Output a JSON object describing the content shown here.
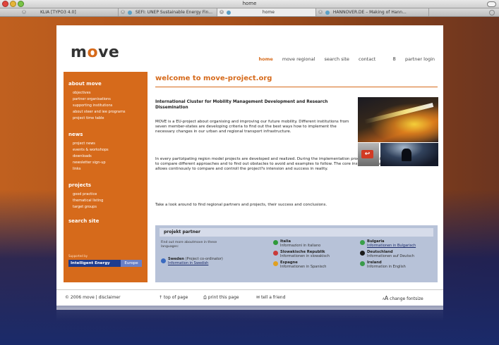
{
  "window": {
    "title": "home",
    "tabs": [
      {
        "label": "KLIA [TYPO3 4.0]"
      },
      {
        "label": "SEFI: UNEP Sustainable Energy Fin..."
      },
      {
        "label": "home"
      },
      {
        "label": "HANNOVER.DE – Making of Hann..."
      }
    ]
  },
  "site": {
    "logo": {
      "m": "m",
      "o": "o",
      "ve": "ve"
    },
    "topnav": [
      "home",
      "move regional",
      "search site",
      "contact"
    ],
    "login": {
      "key": "8",
      "label": "partner login"
    }
  },
  "sidebar": {
    "sections": [
      {
        "title": "about move",
        "items": [
          "objectives",
          "partner organisations",
          "supporting institutions",
          "about steer and iee programs",
          "project time table"
        ]
      },
      {
        "title": "news",
        "items": [
          "project news",
          "events & workshops",
          "downloads",
          "newsletter sign-up",
          "links"
        ]
      },
      {
        "title": "projects",
        "items": [
          "good practice",
          "thematical listing",
          "target groups"
        ]
      },
      {
        "title": "search site",
        "items": []
      }
    ],
    "supported_by": "Supported by",
    "badge_left": "Intelligent Energy",
    "badge_right": "Europe"
  },
  "content": {
    "heading": "welcome to move-project.org",
    "intro_title": "International Cluster for Mobility Management Development and Research Dissemination",
    "paragraph1": "MOVE is a EU-project about organising and improving our future mobility. Different institutions from seven member-states are developing criteria to find out the best ways how to implement the necessary changes in our urban and regional transport infrastructure.",
    "paragraph2": "In every partizipating region model projects are developed and realized. During the implementation process a detailed evaluation will take place to compare different approaches and to find out obstacles to avoid and examples to follow. The core instrument is a fixed table of criteria, which allows continously to compare and controll the project?s intension and success in reality.",
    "paragraph3": "Take a look around to find regional partners and projects, their success and conclusions.",
    "photo_arrow": "↩"
  },
  "partner": {
    "heading": "projekt partner",
    "lead": "Find out more aboutmove in these languages:",
    "sweden": {
      "name": "Sweden",
      "note": "(Project co-ordinator)",
      "link": "Information in Swedish"
    },
    "countries": [
      {
        "name": "Italia",
        "text": "Informazioni in italiano",
        "color": "#2e9a3a"
      },
      {
        "name": "Slowakische Republik",
        "text": "Informationen in slowakisch",
        "color": "#c93a3a"
      },
      {
        "name": "Espagne",
        "text": "Informationen in Spanisch",
        "color": "#e0a020"
      },
      {
        "name": "Bulgaria",
        "text": "Informationen in Bulgarisch",
        "color": "#3aa04a"
      },
      {
        "name": "Deutschland",
        "text": "Informationen auf Deutsch",
        "color": "#d4a020"
      },
      {
        "name": "Ireland",
        "text": "Information in English",
        "color": "#3a9a4a"
      }
    ]
  },
  "footer": {
    "copyright": "© 2006 move | disclaimer",
    "top": "top of page",
    "print": "print this page",
    "tell": "tell a friend",
    "font_small": "A",
    "font_large": "A",
    "fontsize": "change fontsize"
  },
  "colors": {
    "brand_orange": "#d66a1b",
    "partner_blue": "#b7c2d8",
    "badge_blue": "#1e3c8f"
  }
}
